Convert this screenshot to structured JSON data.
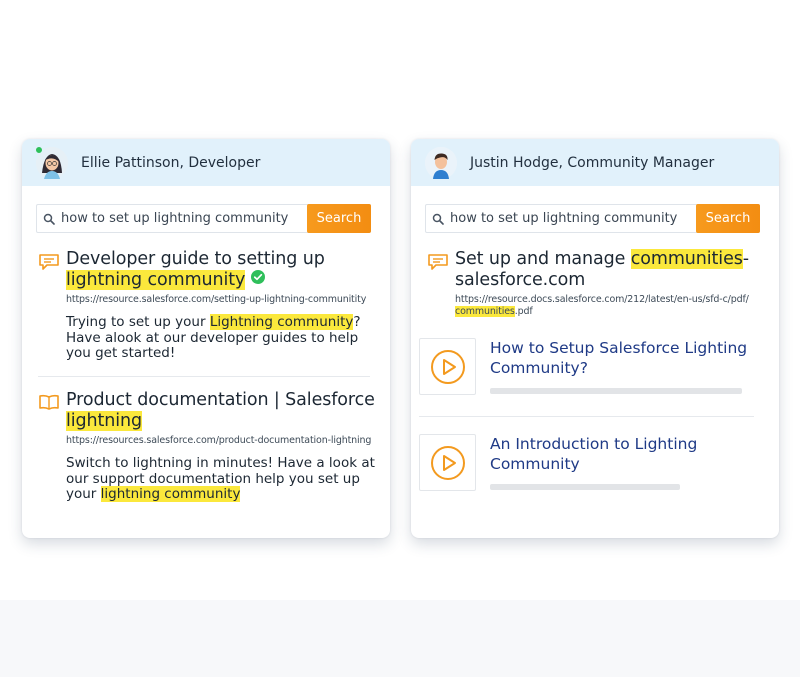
{
  "left_panel": {
    "user": {
      "name": "Ellie Pattinson, Developer",
      "avatar": "woman-avatar",
      "status": "online"
    },
    "search": {
      "query": "how to set up lightning community",
      "button_label": "Search"
    },
    "results": [
      {
        "icon": "chat-bubble-icon",
        "title_plain": "Developer guide to setting up ",
        "title_hl": "lightning community",
        "verified": true,
        "url": "https://resource.salesforce.com/setting-up-lightning-communitity",
        "snippet_pre": "Trying to set up your ",
        "snippet_hl": "Lightning community",
        "snippet_post": "? Have alook at our developer guides to help you get started!"
      },
      {
        "icon": "book-icon",
        "title_plain": "Product documentation | Salesforce ",
        "title_hl": "lightning",
        "url": "https://resources.salesforce.com/product-documentation-lightning",
        "snippet_pre": "Switch to lightning in minutes! Have a look at our support documentation help you set up your ",
        "snippet_hl": "lightning community",
        "snippet_post": ""
      }
    ]
  },
  "right_panel": {
    "user": {
      "name": "Justin Hodge, Community Manager",
      "avatar": "man-avatar"
    },
    "search": {
      "query": "how to set up lightning community",
      "button_label": "Search"
    },
    "result": {
      "icon": "chat-bubble-icon",
      "title_pre": "Set up and manage ",
      "title_hl": "communities",
      "title_post": "-salesforce.com",
      "url_pre": "https://resource.docs.salesforce.com/212/latest/en-us/sfd-c/pdf/",
      "url_hl": "communities",
      "url_post": ".pdf"
    },
    "videos": [
      {
        "title": "How to Setup Salesforce Lighting Community?",
        "icon": "play-icon"
      },
      {
        "title": "An Introduction to Lighting Community",
        "icon": "play-icon"
      }
    ]
  },
  "colors": {
    "header_bg": "#e1f1fb",
    "accent_orange": "#f79a1d",
    "highlight": "#fbe83c",
    "video_title": "#1f3a86",
    "verified_green": "#2fbf5b"
  }
}
